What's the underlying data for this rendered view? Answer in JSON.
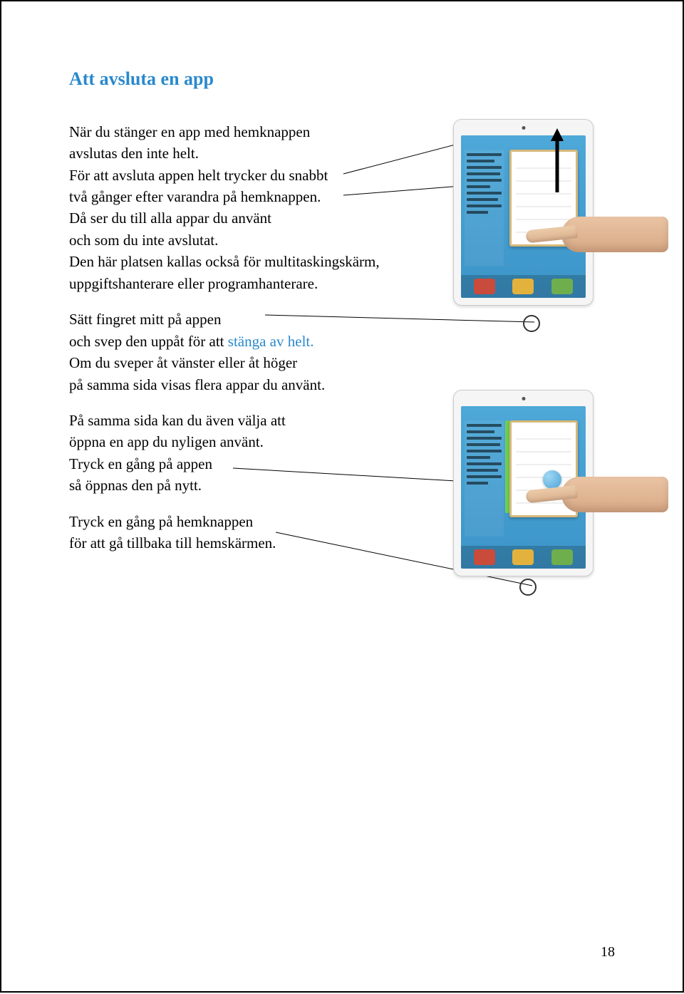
{
  "heading": "Att avsluta en app",
  "p1": {
    "l1": "När du stänger en app med hemknappen",
    "l2": "avslutas den inte helt.",
    "l3": "För att avsluta appen helt trycker du snabbt",
    "l4": "två gånger efter varandra på hemknappen.",
    "l5": "Då ser du till alla appar du använt",
    "l6": "och som du inte avslutat.",
    "l7": "Den här platsen kallas också för multitaskingskärm,",
    "l8": "uppgiftshanterare eller programhanterare."
  },
  "p2": {
    "l1": "Sätt fingret mitt på appen",
    "l2a": "och svep den uppåt för att ",
    "l2b_link": "stänga av helt.",
    "l3": "Om du sveper åt vänster eller åt höger",
    "l4": "på samma sida visas flera appar du använt."
  },
  "p3": {
    "l1": "På samma sida kan du även välja att",
    "l2": "öppna en app du nyligen använt.",
    "l3": "Tryck en gång på appen",
    "l4": "så öppnas den på nytt."
  },
  "p4": {
    "l1": "Tryck en gång på hemknappen",
    "l2": "för att gå tillbaka till hemskärmen."
  },
  "page_number": "18",
  "figures": {
    "tablet1_alt": "iPad multitasking screen with finger swiping app up",
    "tablet2_alt": "iPad multitasking screen with finger tapping app"
  }
}
